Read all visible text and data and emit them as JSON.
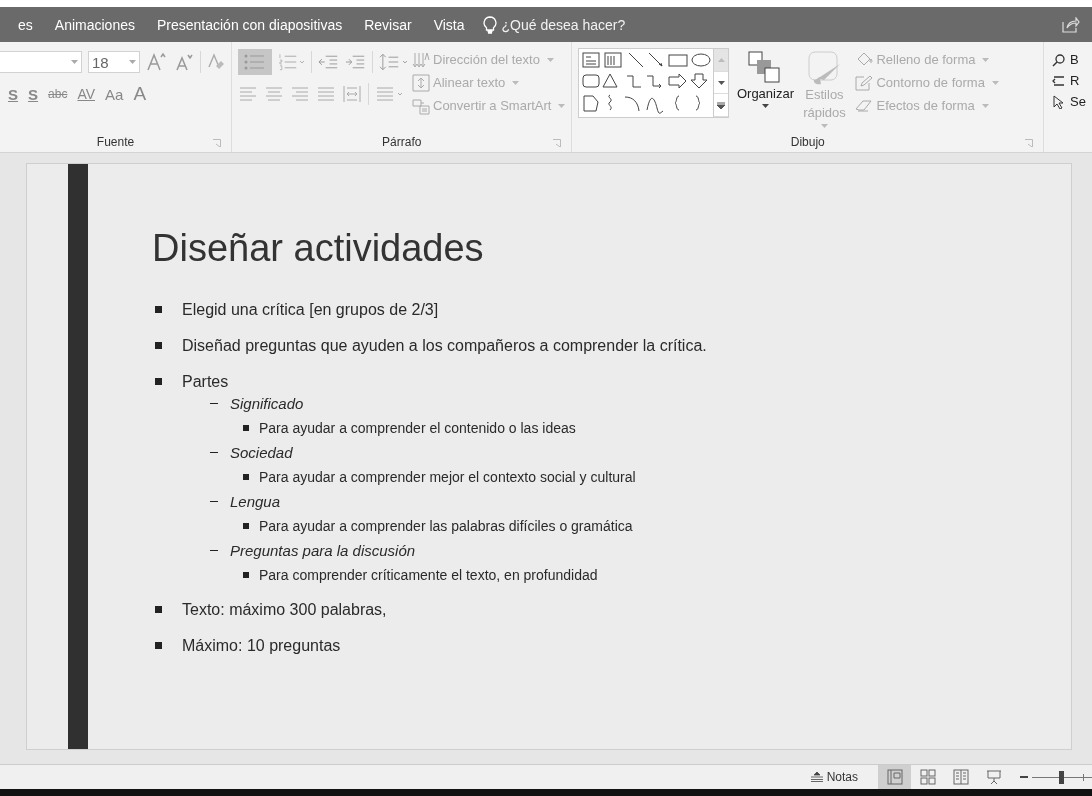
{
  "tabs": [
    {
      "label": "es",
      "selected": false
    },
    {
      "label": "Animaciones",
      "selected": false
    },
    {
      "label": "Presentación con diapositivas",
      "selected": false
    },
    {
      "label": "Revisar",
      "selected": false
    },
    {
      "label": "Vista",
      "selected": false
    }
  ],
  "tell_me": {
    "placeholder": "¿Qué desea hacer?"
  },
  "ribbon": {
    "font": {
      "label": "Fuente",
      "size": "18",
      "buttons": [
        "S",
        "S",
        "abc",
        "AV",
        "Aa",
        "A"
      ]
    },
    "paragraph": {
      "label": "Párrafo",
      "bullets_selected": true,
      "commands": [
        {
          "label": "Dirección del texto",
          "disabled": true
        },
        {
          "label": "Alinear texto",
          "disabled": true
        },
        {
          "label": "Convertir a SmartArt",
          "disabled": true
        }
      ]
    },
    "drawing": {
      "label": "Dibujo",
      "arrange": "Organizar",
      "quick_styles": {
        "label": "Estilos rápidos",
        "disabled": true
      },
      "commands": [
        {
          "label": "Relleno de forma",
          "disabled": true
        },
        {
          "label": "Contorno de forma",
          "disabled": true
        },
        {
          "label": "Efectos de forma",
          "disabled": true
        }
      ]
    },
    "editing": [
      "B",
      "R",
      "Se"
    ]
  },
  "slide": {
    "title": "Diseñar actividades",
    "bullets": [
      {
        "text": "Elegid una crítica [en grupos de 2/3]"
      },
      {
        "text": "Diseñad preguntas que ayuden a los compañeros a comprender la crítica."
      },
      {
        "text": "Partes",
        "children": [
          {
            "text": "Significado",
            "children": [
              {
                "text": "Para ayudar a comprender el contenido o las ideas"
              }
            ]
          },
          {
            "text": "Sociedad",
            "children": [
              {
                "text": "Para ayudar a comprender mejor el contexto social y cultural"
              }
            ]
          },
          {
            "text": "Lengua",
            "children": [
              {
                "text": "Para ayudar a comprender las palabras difíciles o gramática"
              }
            ]
          },
          {
            "text": "Preguntas para la discusión",
            "children": [
              {
                "text": "Para comprender críticamente el texto, en profundidad"
              }
            ]
          }
        ]
      },
      {
        "text": "Texto: máximo 300 palabras,"
      },
      {
        "text": "Máximo: 10 preguntas"
      }
    ]
  },
  "status_bar": {
    "notes": "Notas",
    "views": [
      {
        "selected": true
      },
      {
        "selected": false
      },
      {
        "selected": false
      },
      {
        "selected": false
      }
    ],
    "zoom": {
      "level": 0.45
    }
  }
}
